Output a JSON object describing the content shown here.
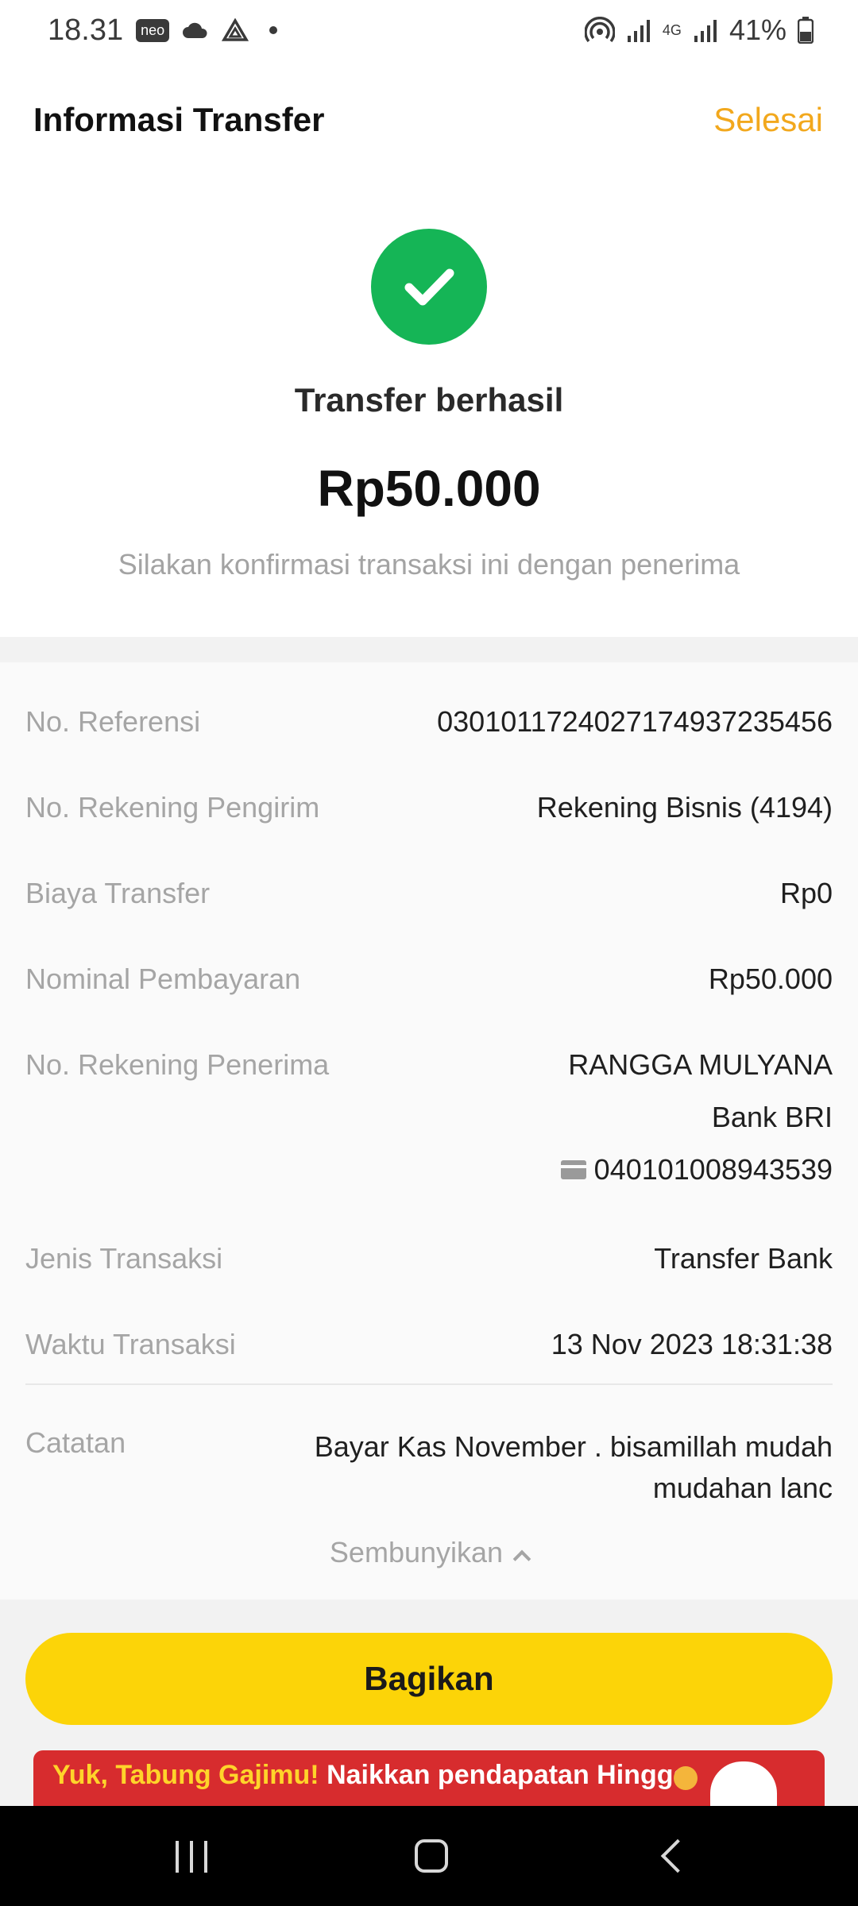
{
  "status_bar": {
    "time": "18.31",
    "carrier_badge": "neo",
    "battery": "41%",
    "network_label": "4G"
  },
  "header": {
    "title": "Informasi Transfer",
    "done_label": "Selesai"
  },
  "result": {
    "title": "Transfer berhasil",
    "amount": "Rp50.000",
    "hint": "Silakan konfirmasi transaksi ini dengan penerima"
  },
  "details": {
    "reference": {
      "label": "No. Referensi",
      "value": "030101172402717493723545 6"
    },
    "sender_account": {
      "label": "No. Rekening Pengirim",
      "value": "Rekening Bisnis (4194)"
    },
    "fee": {
      "label": "Biaya Transfer",
      "value": "Rp0"
    },
    "nominal": {
      "label": "Nominal Pembayaran",
      "value": "Rp50.000"
    },
    "recipient": {
      "label": "No. Rekening Penerima",
      "name": "RANGGA MULYANA",
      "bank": "Bank BRI",
      "account_number": "040101008943539"
    },
    "type": {
      "label": "Jenis Transaksi",
      "value": "Transfer Bank"
    },
    "time": {
      "label": "Waktu Transaksi",
      "value": "13 Nov 2023 18:31:38"
    },
    "note": {
      "label": "Catatan",
      "value": "Bayar Kas November . bisamillah mudah mudahan lanc"
    },
    "hide_label": "Sembunyikan"
  },
  "actions": {
    "share_label": "Bagikan"
  },
  "banner": {
    "highlight": "Yuk, Tabung Gajimu!",
    "text": "Naikkan pendapatan Hingga"
  },
  "colors": {
    "accent": "#f2a81d",
    "success": "#15b556",
    "button": "#fcd408",
    "banner": "#d72c2e"
  }
}
